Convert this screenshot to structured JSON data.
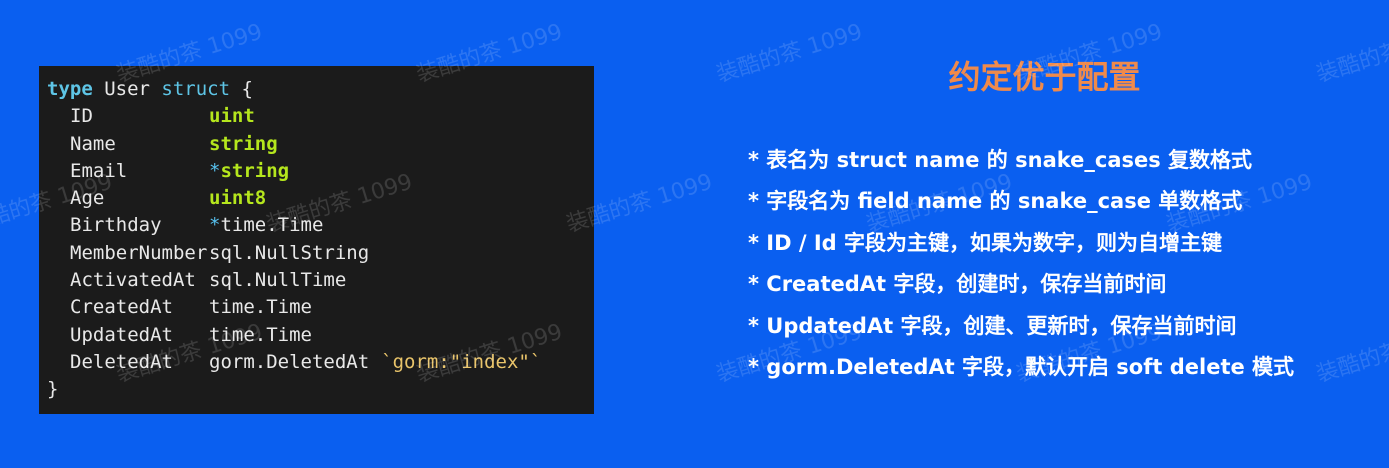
{
  "code": {
    "header": {
      "keyword_type": "type",
      "name": " User ",
      "keyword_struct": "struct",
      "brace": " {"
    },
    "fields": [
      {
        "name": "ID",
        "pointer": "",
        "type": "uint",
        "builtin": true,
        "tag": ""
      },
      {
        "name": "Name",
        "pointer": "",
        "type": "string",
        "builtin": true,
        "tag": ""
      },
      {
        "name": "Email",
        "pointer": "*",
        "type": "string",
        "builtin": true,
        "tag": ""
      },
      {
        "name": "Age",
        "pointer": "",
        "type": "uint8",
        "builtin": true,
        "tag": ""
      },
      {
        "name": "Birthday",
        "pointer": "*",
        "type": "time.Time",
        "builtin": false,
        "tag": ""
      },
      {
        "name": "MemberNumber",
        "pointer": "",
        "type": "sql.NullString",
        "builtin": false,
        "tag": ""
      },
      {
        "name": "ActivatedAt",
        "pointer": "",
        "type": "sql.NullTime",
        "builtin": false,
        "tag": ""
      },
      {
        "name": "CreatedAt",
        "pointer": "",
        "type": "time.Time",
        "builtin": false,
        "tag": ""
      },
      {
        "name": "UpdatedAt",
        "pointer": "",
        "type": "time.Time",
        "builtin": false,
        "tag": ""
      },
      {
        "name": "DeletedAt",
        "pointer": "",
        "type": "gorm.DeletedAt",
        "builtin": false,
        "tag": "`gorm:\"index\"`"
      }
    ],
    "closing": "}"
  },
  "title": "约定优于配置",
  "bullets": [
    "* 表名为 struct name 的 snake_cases 复数格式",
    "* 字段名为 field name 的 snake_case 单数格式",
    "* ID / Id 字段为主键，如果为数字，则为自增主键",
    "* CreatedAt 字段，创建时，保存当前时间",
    "* UpdatedAt 字段，创建、更新时，保存当前时间",
    "* gorm.DeletedAt 字段，默认开启 soft delete 模式"
  ],
  "watermark": "装酷的茶 1099",
  "colors": {
    "background": "#0a5ff0",
    "code_background": "#1b1b1b",
    "title": "#f08a4b",
    "keyword": "#5ec5e6",
    "builtin_type": "#b5e61d",
    "tag": "#e9c46a"
  }
}
